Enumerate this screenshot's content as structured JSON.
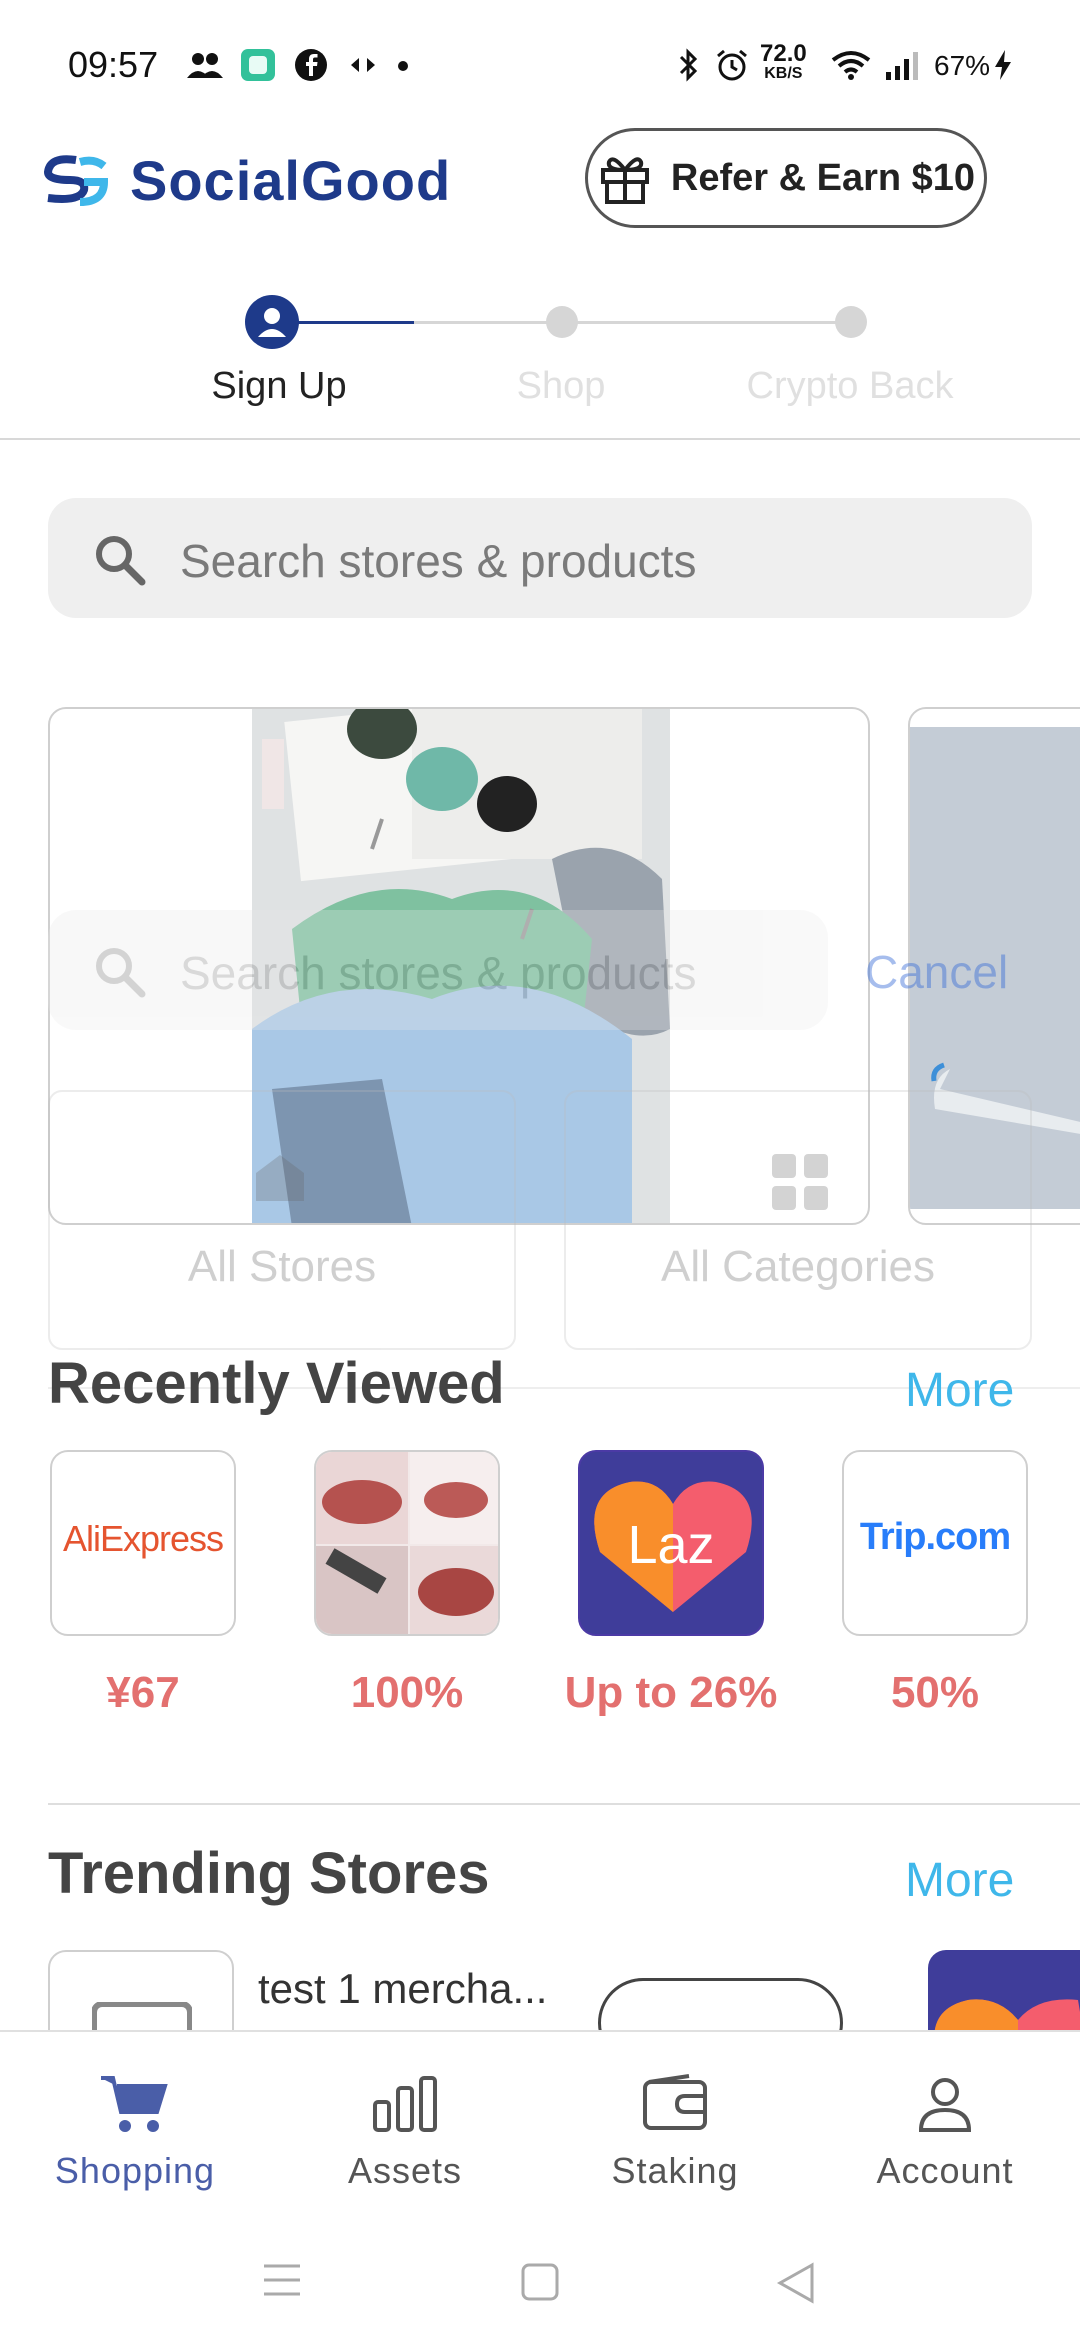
{
  "status_bar": {
    "time": "09:57",
    "network_speed_value": "72.0",
    "network_speed_unit": "KB/S",
    "battery": "67%"
  },
  "header": {
    "logo_text": "SocialGood",
    "refer_button": "Refer & Earn $10"
  },
  "stepper": {
    "steps": [
      {
        "label": "Sign Up",
        "active": true
      },
      {
        "label": "Shop",
        "active": false
      },
      {
        "label": "Crypto Back",
        "active": false
      }
    ]
  },
  "search": {
    "placeholder": "Search stores & products"
  },
  "overlay": {
    "search_placeholder": "Search stores & products",
    "cancel_label": "Cancel",
    "all_stores_label": "All Stores",
    "all_categories_label": "All Categories"
  },
  "recently_viewed": {
    "title": "Recently Viewed",
    "more_label": "More",
    "items": [
      {
        "name": "AliExpress",
        "logo_text": "AliExpress",
        "value": "¥67"
      },
      {
        "name": "lip-product",
        "logo_text": "",
        "value": "100%"
      },
      {
        "name": "Lazada",
        "logo_text": "Laz",
        "value": "Up to 26%"
      },
      {
        "name": "Trip.com",
        "logo_text": "Trip.com",
        "value": "50%"
      }
    ]
  },
  "trending_stores": {
    "title": "Trending Stores",
    "more_label": "More",
    "first_store_name": "test 1 mercha..."
  },
  "bottom_nav": {
    "items": [
      {
        "label": "Shopping",
        "icon": "cart-icon",
        "active": true
      },
      {
        "label": "Assets",
        "icon": "bar-chart-icon",
        "active": false
      },
      {
        "label": "Staking",
        "icon": "wallet-icon",
        "active": false
      },
      {
        "label": "Account",
        "icon": "person-icon",
        "active": false
      }
    ]
  },
  "colors": {
    "brand": "#1e3a8a",
    "accent": "#3fb7ea",
    "value_red": "#e3706f",
    "nav_active": "#4a5ea8"
  }
}
